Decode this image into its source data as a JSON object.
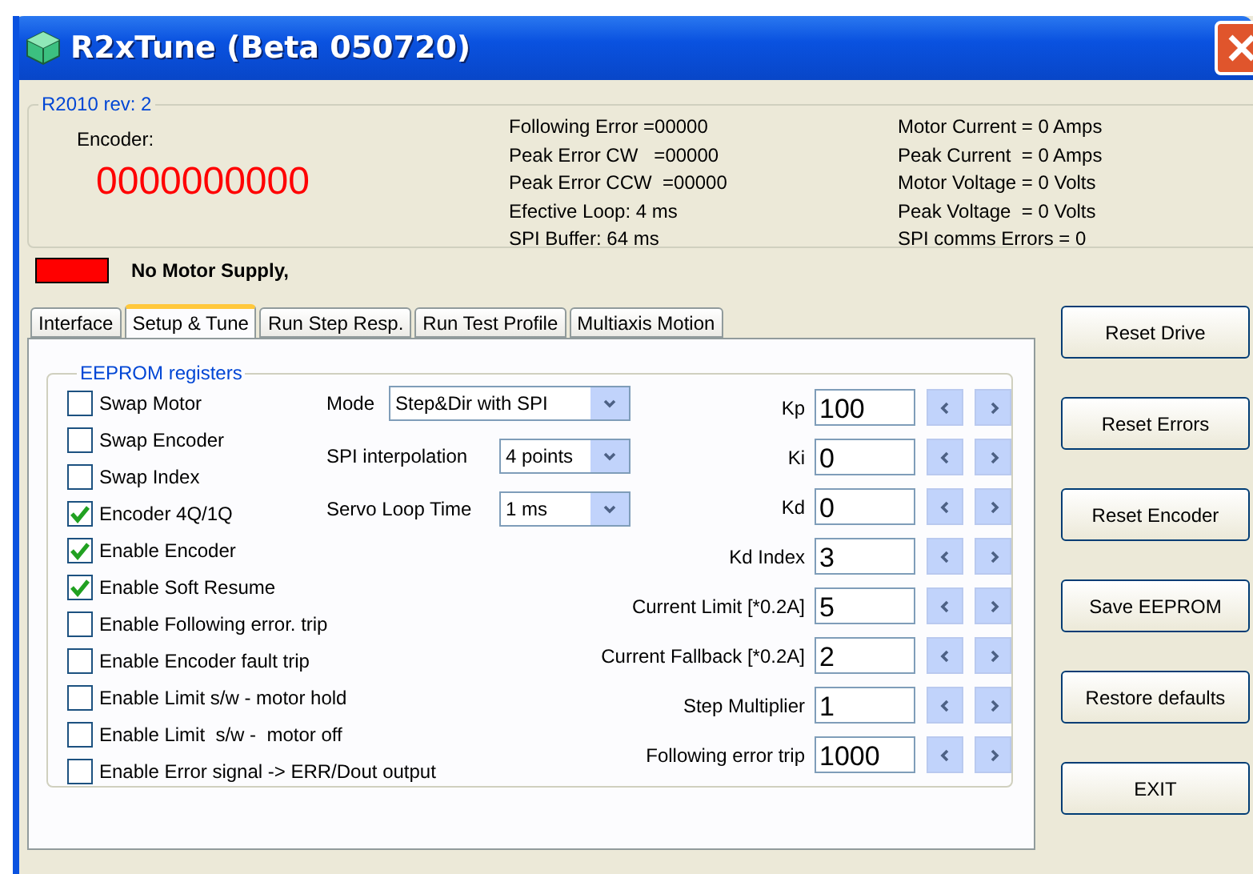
{
  "window": {
    "title": "R2xTune (Beta 050720)"
  },
  "status_group": {
    "title": "R2010 rev: 2",
    "encoder_label": "Encoder:",
    "encoder_value": "0000000000",
    "column_1": [
      "Following Error =00000",
      "Peak Error CW   =00000",
      "Peak Error CCW  =00000",
      "Efective Loop: 4 ms",
      "SPI Buffer: 64 ms"
    ],
    "column_2": [
      "Motor Current = 0 Amps",
      "Peak Current  = 0 Amps",
      "Motor Voltage = 0 Volts",
      "Peak Voltage  = 0 Volts",
      "SPI comms Errors = 0"
    ]
  },
  "supply": {
    "ok": false,
    "label": "No Motor Supply,"
  },
  "tabs": [
    {
      "label": "Interface",
      "selected": false
    },
    {
      "label": "Setup & Tune",
      "selected": true
    },
    {
      "label": "Run Step Resp.",
      "selected": false
    },
    {
      "label": "Run Test Profile",
      "selected": false
    },
    {
      "label": "Multiaxis Motion",
      "selected": false
    }
  ],
  "eeprom": {
    "title": "EEPROM registers",
    "checkboxes": [
      {
        "label": "Swap Motor",
        "checked": false
      },
      {
        "label": "Swap Encoder",
        "checked": false
      },
      {
        "label": "Swap Index",
        "checked": false
      },
      {
        "label": "Encoder 4Q/1Q",
        "checked": true
      },
      {
        "label": "Enable Encoder",
        "checked": true
      },
      {
        "label": "Enable Soft Resume",
        "checked": true
      },
      {
        "label": "Enable Following error. trip",
        "checked": false
      },
      {
        "label": "Enable Encoder fault trip",
        "checked": false
      },
      {
        "label": "Enable Limit s/w - motor hold",
        "checked": false
      },
      {
        "label": "Enable Limit  s/w -  motor off",
        "checked": false
      },
      {
        "label": "Enable Error signal -> ERR/Dout output",
        "checked": false
      }
    ],
    "selects": [
      {
        "label": "Mode",
        "value": "Step&Dir with SPI"
      },
      {
        "label": "SPI interpolation",
        "value": "4 points"
      },
      {
        "label": "Servo Loop Time",
        "value": "1 ms"
      }
    ],
    "spinners": [
      {
        "label": "Kp",
        "value": "100"
      },
      {
        "label": "Ki",
        "value": "0"
      },
      {
        "label": "Kd",
        "value": "0"
      },
      {
        "label": "Kd Index",
        "value": "3"
      },
      {
        "label": "Current Limit [*0.2A]",
        "value": "5"
      },
      {
        "label": "Current Fallback [*0.2A]",
        "value": "2"
      },
      {
        "label": "Step Multiplier",
        "value": "1"
      },
      {
        "label": "Following error trip",
        "value": "1000"
      }
    ]
  },
  "buttons": [
    "Reset Drive",
    "Reset Errors",
    "Reset Encoder",
    "Save EEPROM",
    "Restore defaults",
    "EXIT"
  ]
}
